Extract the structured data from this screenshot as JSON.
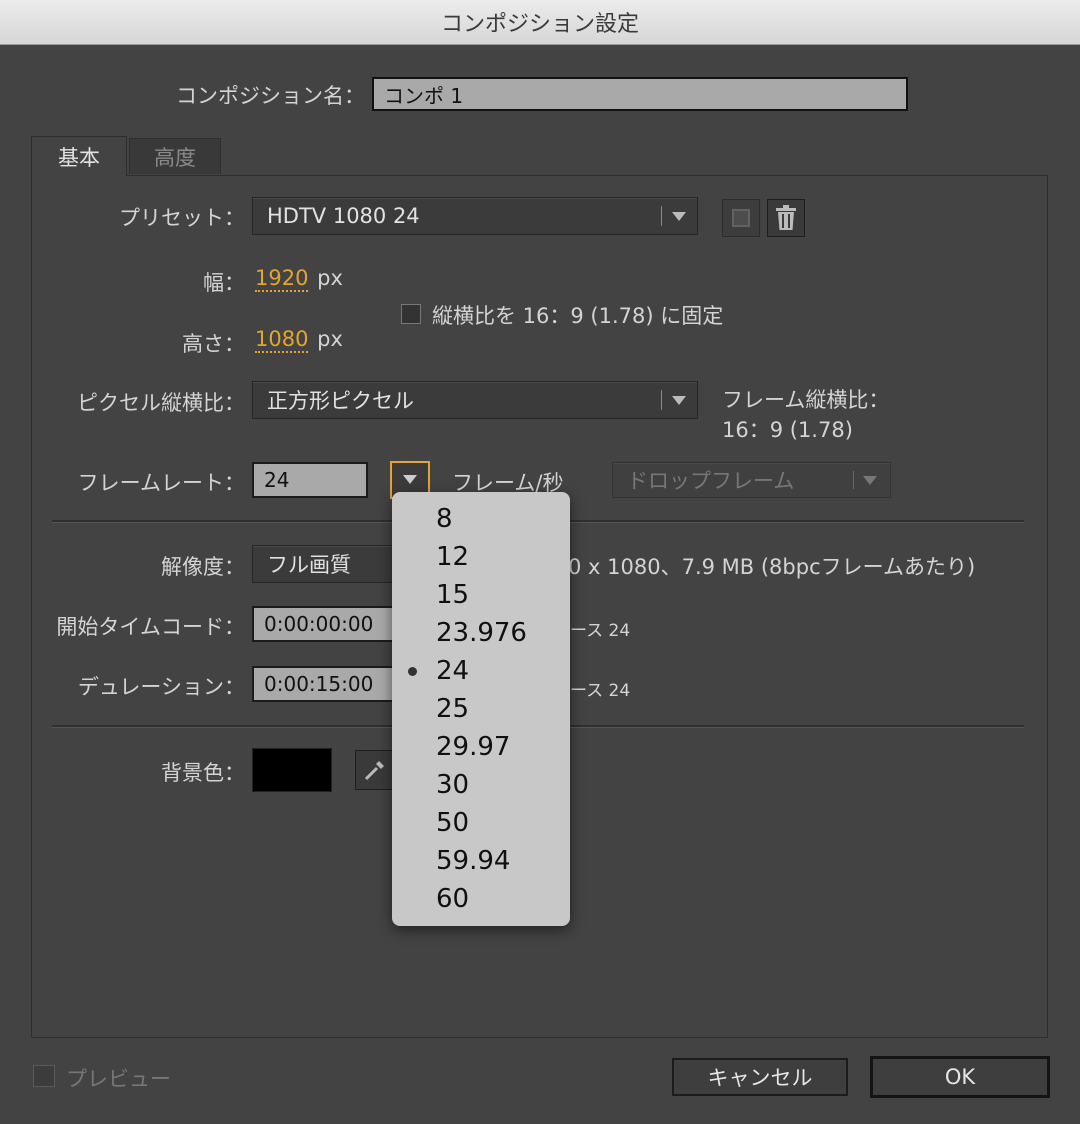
{
  "window": {
    "title": "コンポジション設定"
  },
  "comp_name": {
    "label": "コンポジション名：",
    "value": "コンポ 1"
  },
  "tabs": [
    {
      "label": "基本",
      "selected": true
    },
    {
      "label": "高度",
      "selected": false
    }
  ],
  "preset": {
    "label": "プリセット：",
    "value": "HDTV 1080 24"
  },
  "width": {
    "label": "幅：",
    "value": "1920",
    "unit": "px"
  },
  "height": {
    "label": "高さ：",
    "value": "1080",
    "unit": "px"
  },
  "lock_aspect": {
    "label": "縦横比を 16：9 (1.78) に固定",
    "checked": false
  },
  "pixel_aspect": {
    "label": "ピクセル縦横比：",
    "value": "正方形ピクセル"
  },
  "frame_aspect": {
    "label": "フレーム縦横比：",
    "value": "16：9 (1.78)"
  },
  "frame_rate": {
    "label": "フレームレート：",
    "value": "24",
    "unit": "フレーム/秒",
    "drop_frame": "ドロップフレーム"
  },
  "resolution": {
    "label": "解像度：",
    "value": "フル画質",
    "info": "0 x 1080、7.9 MB (8bpcフレームあたり)"
  },
  "start_timecode": {
    "label": "開始タイムコード：",
    "value": "0:00:00:00",
    "base": "ース 24"
  },
  "duration": {
    "label": "デュレーション：",
    "value": "0:00:15:00",
    "base": "ース 24"
  },
  "background": {
    "label": "背景色：",
    "color": "#000000"
  },
  "preview": {
    "label": "プレビュー",
    "checked": false
  },
  "buttons": {
    "cancel": "キャンセル",
    "ok": "OK"
  },
  "framerate_menu": {
    "options": [
      "8",
      "12",
      "15",
      "23.976",
      "24",
      "25",
      "29.97",
      "30",
      "50",
      "59.94",
      "60"
    ],
    "selected": "24"
  },
  "colors": {
    "accent_orange": "#e3a531",
    "dialog_bg": "#434343",
    "menu_bg": "#c8c8c8"
  }
}
